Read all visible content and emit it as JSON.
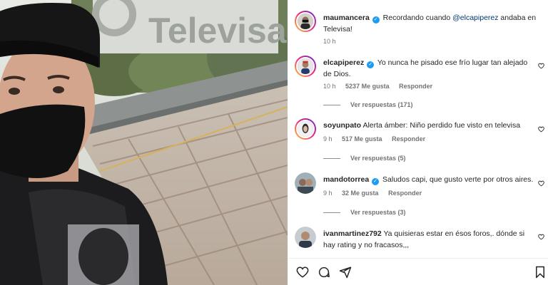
{
  "post": {
    "author": "maumancera",
    "caption_prefix": "Recordando cuando ",
    "caption_mention": "@elcapiperez",
    "caption_suffix": " andaba en Televisa!",
    "time": "10 h",
    "photo_sign": "Televisa"
  },
  "comments": [
    {
      "user": "elcapiperez",
      "verified": true,
      "text": "Yo nunca he pisado ese frío lugar tan alejado de Dios.",
      "time": "10 h",
      "likes": "5237 Me gusta",
      "reply": "Responder",
      "view_replies": "Ver respuestas (171)"
    },
    {
      "user": "soyunpato",
      "verified": false,
      "text": "Alerta ámber: Niño perdido fue visto en televisa",
      "time": "9 h",
      "likes": "517 Me gusta",
      "reply": "Responder",
      "view_replies": "Ver respuestas (5)"
    },
    {
      "user": "mandotorrea",
      "verified": true,
      "text": "Saludos capi, que gusto verte por otros aires.",
      "time": "9 h",
      "likes": "32 Me gusta",
      "reply": "Responder",
      "view_replies": "Ver respuestas (3)"
    },
    {
      "user": "ivanmartinez792",
      "verified": false,
      "text": "Ya quisieras estar en ésos foros,. dónde si hay rating y no fracasos,,,"
    }
  ],
  "actions": {
    "icons": [
      "heart-icon",
      "comment-icon",
      "share-icon",
      "bookmark-icon"
    ]
  },
  "colors": {
    "verified": "#1d9bf0",
    "mention": "#00376b",
    "muted": "#737373"
  }
}
